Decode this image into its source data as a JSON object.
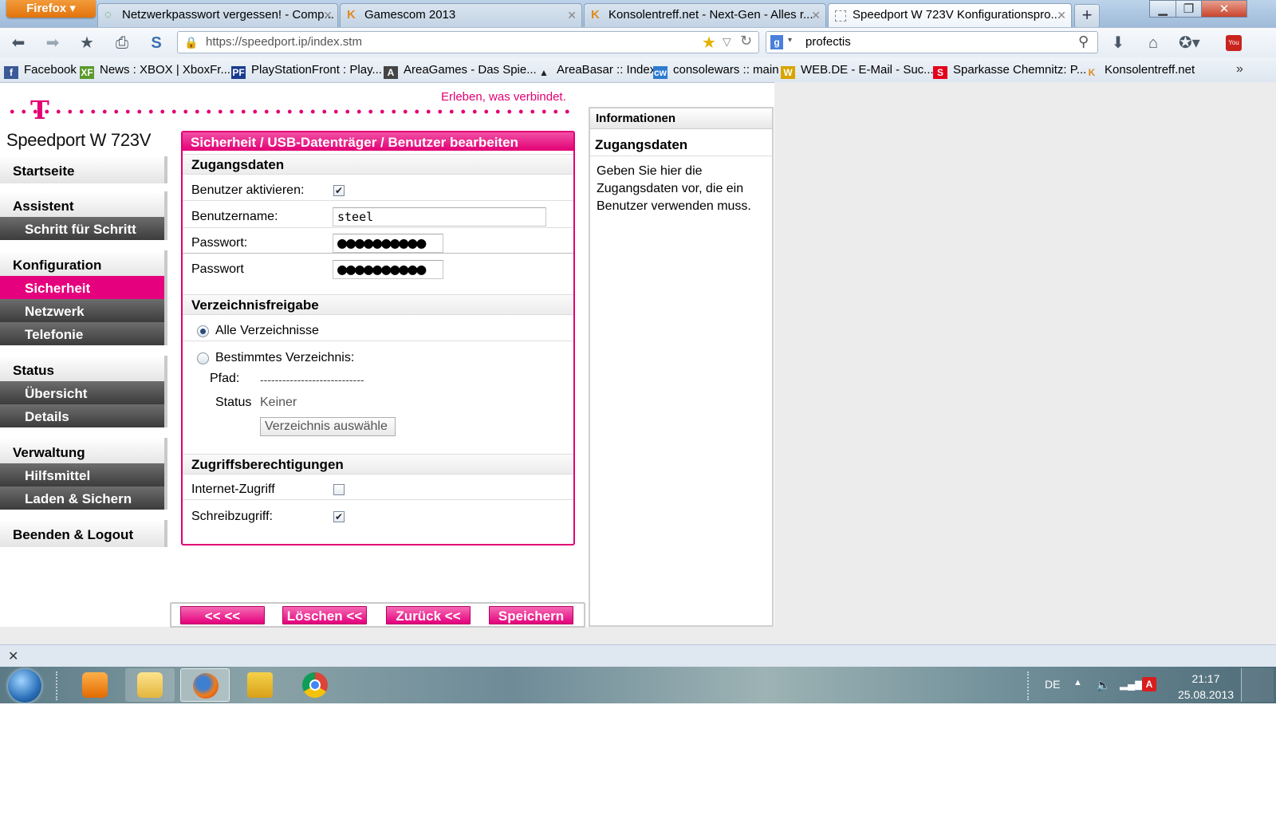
{
  "browser": {
    "menu_label": "Firefox",
    "tabs": [
      {
        "label": "Netzwerkpasswort vergessen! - Comp..."
      },
      {
        "label": "Gamescom 2013"
      },
      {
        "label": "Konsolentreff.net - Next-Gen - Alles r..."
      },
      {
        "label": "Speedport W 723V Konfigurationspro..."
      }
    ],
    "url": "https://speedport.ip/index.stm",
    "search_value": "profectis",
    "bookmarks": [
      {
        "label": "Facebook",
        "icon": "facebook-icon",
        "color": "#3b5998",
        "glyph": "f"
      },
      {
        "label": "News : XBOX | XboxFr...",
        "icon": "xf-icon",
        "color": "#5a9a2c",
        "glyph": "XF"
      },
      {
        "label": "PlayStationFront : Play...",
        "icon": "pf-icon",
        "color": "#1a3c8f",
        "glyph": "PF"
      },
      {
        "label": "AreaGames - Das Spie...",
        "icon": "areagames-icon",
        "color": "#444444",
        "glyph": "A"
      },
      {
        "label": "AreaBasar :: Index",
        "icon": "areabasar-icon",
        "color": "#222222",
        "glyph": "▲"
      },
      {
        "label": "consolewars :: main",
        "icon": "consolewars-icon",
        "color": "#2d7bd0",
        "glyph": "cw"
      },
      {
        "label": "WEB.DE - E-Mail - Suc...",
        "icon": "webde-icon",
        "color": "#d8a400",
        "glyph": "W"
      },
      {
        "label": "Sparkasse Chemnitz: P...",
        "icon": "sparkasse-icon",
        "color": "#e3001b",
        "glyph": "S"
      },
      {
        "label": "Konsolentreff.net",
        "icon": "konsolentreff-icon",
        "color": "#e08a1c",
        "glyph": "K"
      }
    ]
  },
  "page": {
    "slogan": "Erleben, was verbindet.",
    "logo": "T",
    "model": "Speedport W 723V",
    "sidebar": {
      "startseite": "Startseite",
      "assistent": "Assistent",
      "schritt": "Schritt für Schritt",
      "konfiguration": "Konfiguration",
      "sicherheit": "Sicherheit",
      "netzwerk": "Netzwerk",
      "telefonie": "Telefonie",
      "status": "Status",
      "uebersicht": "Übersicht",
      "details": "Details",
      "verwaltung": "Verwaltung",
      "hilfsmittel": "Hilfsmittel",
      "laden": "Laden & Sichern",
      "logout": "Beenden & Logout"
    },
    "main": {
      "header": "Sicherheit / USB-Datenträger / Benutzer bearbeiten",
      "zugangsdaten_title": "Zugangsdaten",
      "benutzer_aktivieren_label": "Benutzer aktivieren:",
      "benutzer_aktivieren_checked": true,
      "benutzername_label": "Benutzername:",
      "benutzername_value": "steel",
      "passwort_label": "Passwort:",
      "passwort_value": "●●●●●●●●●●",
      "passwort2_label": "Passwort",
      "passwort2_value": "●●●●●●●●●●",
      "verzeichnis_title": "Verzeichnisfreigabe",
      "alle_label": "Alle Verzeichnisse",
      "bestimmtes_label": "Bestimmtes Verzeichnis:",
      "pfad_label": "Pfad:",
      "pfad_value": "----------------------------",
      "status_label": "Status",
      "status_value": "Keiner",
      "auswaehlen_label": "Verzeichnis auswähle",
      "rechte_title": "Zugriffsberechtigungen",
      "internet_label": "Internet-Zugriff",
      "internet_checked": false,
      "schreib_label": "Schreibzugriff:",
      "schreib_checked": true
    },
    "buttons": {
      "back": "<<  <<",
      "loeschen": "Löschen <<",
      "zurueck": "Zurück <<",
      "speichern": "Speichern"
    },
    "info": {
      "title": "Informationen",
      "subtitle": "Zugangsdaten",
      "text": "Geben Sie hier die Zugangsdaten vor, die ein Benutzer verwenden muss."
    }
  },
  "taskbar": {
    "language": "DE",
    "time": "21:17",
    "date": "25.08.2013"
  },
  "colors": {
    "telekom_magenta": "#e20074",
    "sidebar_dark": "#4a4a4a"
  }
}
